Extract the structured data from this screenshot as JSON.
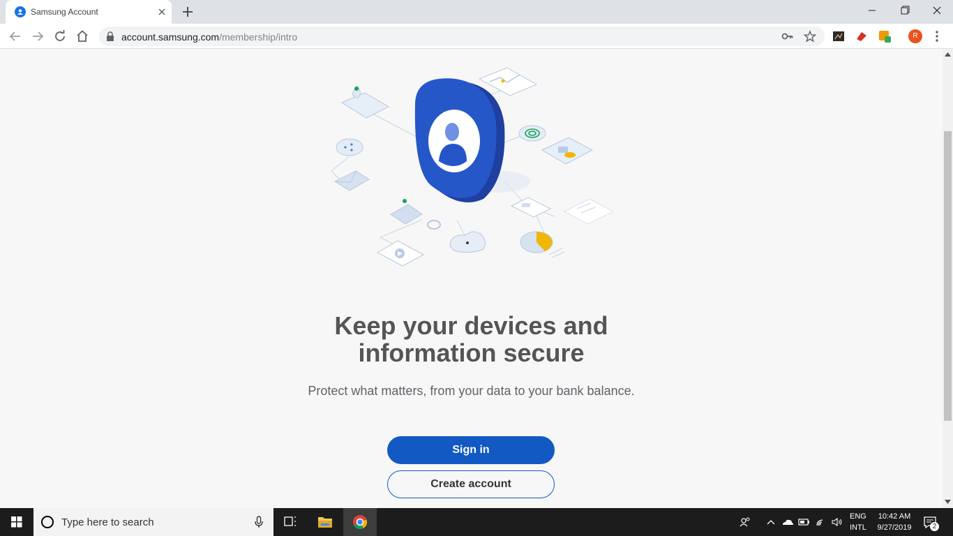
{
  "browser": {
    "tab_title": "Samsung Account",
    "url_host": "account.samsung.com",
    "url_path": "/membership/intro",
    "profile_initial": "R"
  },
  "page": {
    "headline_line1": "Keep your devices and",
    "headline_line2": "information secure",
    "subtext": "Protect what matters, from your data to your bank balance.",
    "sign_in_label": "Sign in",
    "create_account_label": "Create account"
  },
  "taskbar": {
    "search_placeholder": "Type here to search",
    "lang_line1": "ENG",
    "lang_line2": "INTL",
    "time": "10:42 AM",
    "date": "9/27/2019",
    "notification_count": "2"
  },
  "colors": {
    "accent": "#1259c3",
    "page_background": "#f7f7f7",
    "taskbar": "#1c1c1c"
  }
}
